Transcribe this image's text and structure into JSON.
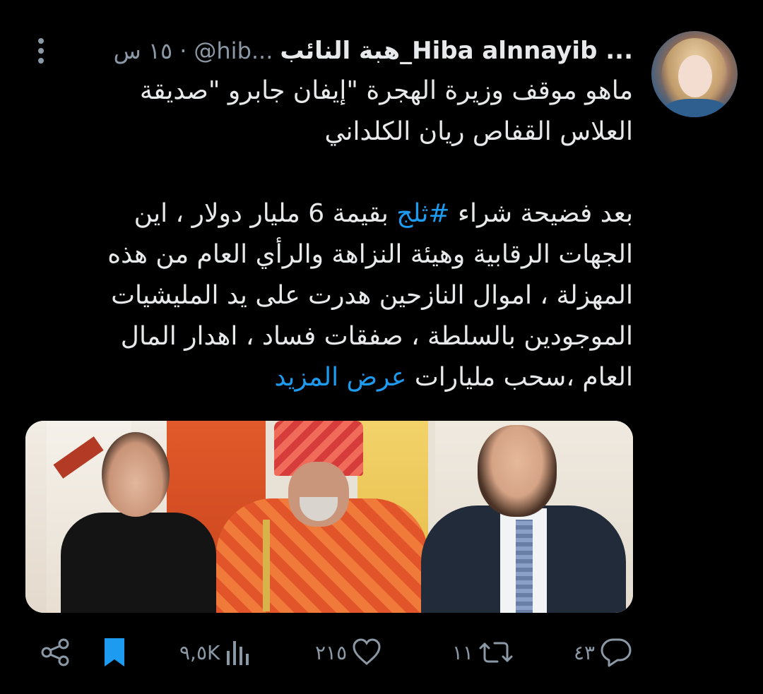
{
  "tweet": {
    "display_name": "هبة النائب_Hiba alnnayib ...",
    "handle": "@hib...",
    "separator": "·",
    "time": "١٥ س",
    "body": {
      "para1_line1": "ماهو موقف وزيرة الهجرة \"إيفان جابرو \"صديقة",
      "para1_line2": "العلاس القفاص ريان الكلداني",
      "para2_line1_part1": "بعد فضيحة شراء ",
      "para2_hashtag": "#ثلج",
      "para2_line1_part2": " بقيمة 6 مليار دولار ، اين",
      "para2_line2": "الجهات الرقابية وهيئة النزاهة والرأي العام من هذه",
      "para2_line3": "المهزلة ، اموال النازحين هدرت على يد المليشيات",
      "para2_line4": "الموجودين بالسلطة ، صفقات فساد ، اهدار المال",
      "para2_line5": "العام ،سحب مليارات ",
      "show_more": "عرض المزيد"
    },
    "actions": {
      "replies": "٤٣",
      "retweets": "١١",
      "likes": "٢١٥",
      "views": "٩,٥K"
    }
  },
  "colors": {
    "background": "#000000",
    "text": "#e7e9ea",
    "muted": "#8b98a5",
    "link": "#1d9bf0",
    "bookmark": "#1d9bf0"
  },
  "icons": {
    "more": "more-vertical-icon",
    "reply": "reply-icon",
    "retweet": "retweet-icon",
    "like": "heart-icon",
    "views": "views-chart-icon",
    "bookmark": "bookmark-filled-icon",
    "share": "share-icon"
  }
}
